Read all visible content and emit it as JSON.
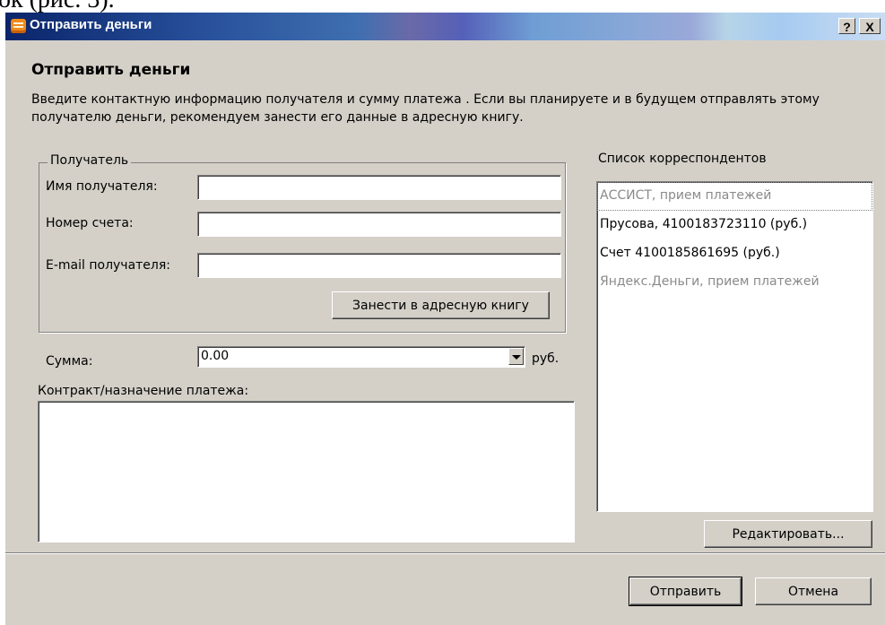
{
  "page_top_fragment": "ок (рис. 3).",
  "window": {
    "title": "Отправить деньги",
    "help_button": "?",
    "close_button": "X"
  },
  "heading": "Отправить деньги",
  "intro_text": "Введите контактную информацию получателя и сумму платежа . Если вы планируете и в будущем отправлять этому получателю деньги, рекомендуем занести его данные в адресную книгу.",
  "recipient": {
    "legend": "Получатель",
    "name_label": "Имя получателя:",
    "name_value": "",
    "account_label": "Номер счета:",
    "account_value": "",
    "email_label": "E-mail получателя:",
    "email_value": "",
    "add_to_book_button": "Занести в адресную книгу"
  },
  "amount": {
    "label": "Сумма:",
    "value": "0.00",
    "currency": "руб."
  },
  "purpose": {
    "label": "Контракт/назначение платежа:",
    "value": ""
  },
  "correspondents": {
    "label": "Список корреспондентов",
    "items": [
      {
        "text": "АССИСТ, прием платежей",
        "muted": true
      },
      {
        "text": "Прусова,  4100183723110 (руб.)",
        "muted": false
      },
      {
        "text": "Счет 4100185861695 (руб.)",
        "muted": false
      },
      {
        "text": "Яндекс.Деньги, прием платежей",
        "muted": true
      }
    ],
    "edit_button": "Редактировать..."
  },
  "footer": {
    "send_button": "Отправить",
    "cancel_button": "Отмена"
  },
  "colors": {
    "dialog_bg": "#d4d0c8",
    "title_icon": "#f08a1c",
    "muted_text": "#8a8a8a"
  }
}
